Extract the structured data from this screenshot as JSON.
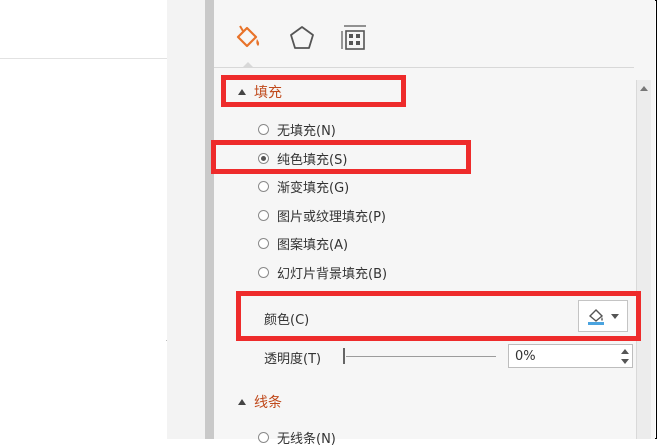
{
  "tabs": [
    {
      "name": "fill-line-tab",
      "icon": "paint-bucket-icon",
      "active": true
    },
    {
      "name": "effects-tab",
      "icon": "pentagon-icon"
    },
    {
      "name": "size-properties-tab",
      "icon": "size-position-icon"
    }
  ],
  "fill_section": {
    "title": "填充",
    "options": [
      {
        "label": "无填充(N)",
        "checked": false
      },
      {
        "label": "纯色填充(S)",
        "checked": true
      },
      {
        "label": "渐变填充(G)",
        "checked": false
      },
      {
        "label": "图片或纹理填充(P)",
        "checked": false
      },
      {
        "label": "图案填充(A)",
        "checked": false
      },
      {
        "label": "幻灯片背景填充(B)",
        "checked": false
      }
    ],
    "color_label": "颜色(C)",
    "transparency_label": "透明度(T)",
    "transparency_value": "0%"
  },
  "line_section": {
    "title": "线条",
    "first_option": "无线条(N)"
  },
  "colors": {
    "highlight": "#ee2b2b",
    "section_title": "#c04a1c",
    "bucket_accent": "#e8732a"
  }
}
